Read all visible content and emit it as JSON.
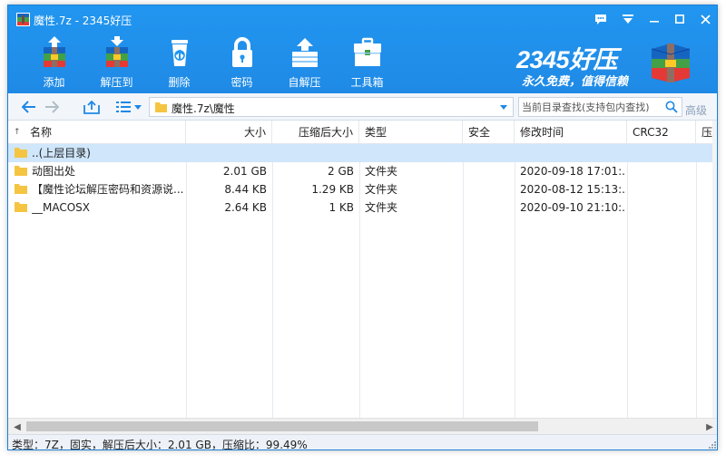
{
  "window": {
    "title": "魔性.7z - 2345好压",
    "controls": [
      "feedback-icon",
      "menu-icon",
      "minimize-icon",
      "maximize-icon",
      "close-icon"
    ]
  },
  "toolbar": {
    "items": [
      {
        "label": "添加",
        "icon": "add-archive-icon"
      },
      {
        "label": "解压到",
        "icon": "extract-to-icon"
      },
      {
        "label": "删除",
        "icon": "delete-icon"
      },
      {
        "label": "密码",
        "icon": "lock-icon"
      },
      {
        "label": "自解压",
        "icon": "self-extract-icon"
      },
      {
        "label": "工具箱",
        "icon": "toolbox-icon"
      }
    ]
  },
  "brand": {
    "name": "2345好压",
    "slogan": "永久免费，值得信赖"
  },
  "addressbar": {
    "path": "魔性.7z\\魔性",
    "search_placeholder": "当前目录查找(支持包内查找)",
    "advanced_label": "高级"
  },
  "table": {
    "headers": [
      "名称",
      "大小",
      "压缩后大小",
      "类型",
      "安全",
      "修改时间",
      "CRC32",
      "压"
    ],
    "rows": [
      {
        "name": "..(上层目录)",
        "size": "",
        "packed": "",
        "type": "",
        "security": "",
        "modified": "",
        "crc": "",
        "selected": true
      },
      {
        "name": "动图出处",
        "size": "2.01 GB",
        "packed": "2 GB",
        "type": "文件夹",
        "security": "",
        "modified": "2020-09-18 17:01:...",
        "crc": "",
        "selected": false
      },
      {
        "name": "【魔性论坛解压密码和资源说...",
        "size": "8.44 KB",
        "packed": "1.29 KB",
        "type": "文件夹",
        "security": "",
        "modified": "2020-08-12 15:13:...",
        "crc": "",
        "selected": false
      },
      {
        "name": "__MACOSX",
        "size": "2.64 KB",
        "packed": "1 KB",
        "type": "文件夹",
        "security": "",
        "modified": "2020-09-10 21:10:...",
        "crc": "",
        "selected": false
      }
    ]
  },
  "status": {
    "text": "类型：7Z，固实，解压后大小：2.01 GB，压缩比：99.49%"
  },
  "colors": {
    "titlebar": "#2196f0",
    "selection": "#cfe6fb",
    "folder": "#f5c542"
  }
}
